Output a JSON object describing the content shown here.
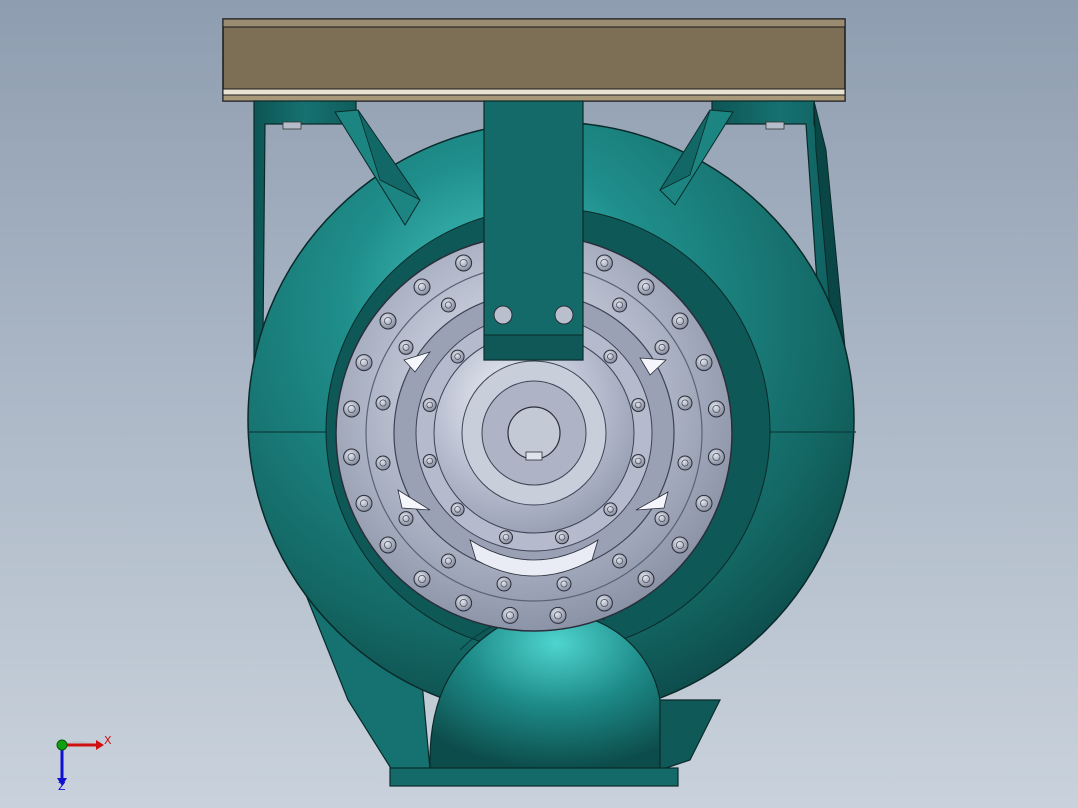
{
  "viewport": {
    "colors": {
      "background_top": "#8e9db0",
      "background_bottom": "#c9d2dc",
      "volute": "#1f8482",
      "volute_highlight": "#48c6c2",
      "volute_shadow": "#0c4a4a",
      "base_plate": "#7d6f55",
      "cover_plate": "#a8aebe",
      "bolt": "#b4bac8",
      "edge": "#1a2a2a"
    }
  },
  "triad": {
    "x_label": "X",
    "z_label": "Z",
    "colors": {
      "x": "#d01010",
      "y": "#10a010",
      "z": "#1010d0"
    }
  }
}
